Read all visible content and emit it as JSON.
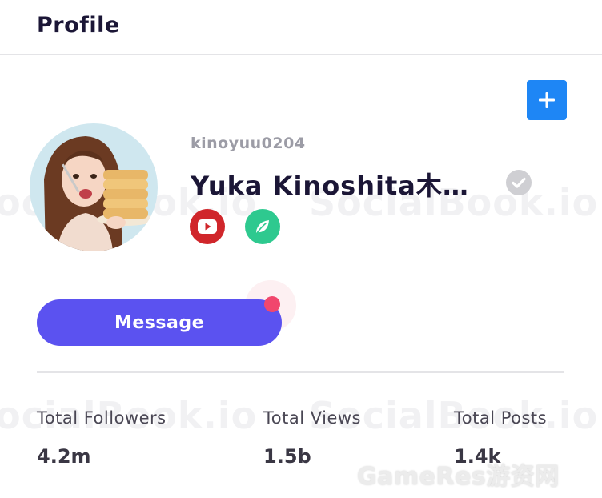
{
  "header": {
    "title": "Profile"
  },
  "watermark": {
    "text": "SocialBook.io"
  },
  "profile": {
    "username": "kinoyuu0204",
    "display_name": "Yuka Kinoshita木…",
    "verified": true,
    "add_button_icon": "plus-icon",
    "socials": [
      {
        "platform": "youtube",
        "icon": "youtube-icon",
        "color": "#d0262b"
      },
      {
        "platform": "leaf",
        "icon": "leaf-icon",
        "color": "#2ec98f"
      }
    ]
  },
  "actions": {
    "message_label": "Message"
  },
  "stats": [
    {
      "label": "Total Followers",
      "value": "4.2m"
    },
    {
      "label": "Total Views",
      "value": "1.5b"
    },
    {
      "label": "Total Posts",
      "value": "1.4k"
    }
  ],
  "overlay_watermark": {
    "text": "GameRes游资网"
  },
  "colors": {
    "accent": "#5b52f0",
    "add_button": "#1e86f5",
    "notification": "#f1476d",
    "text_dark": "#1b1636"
  }
}
